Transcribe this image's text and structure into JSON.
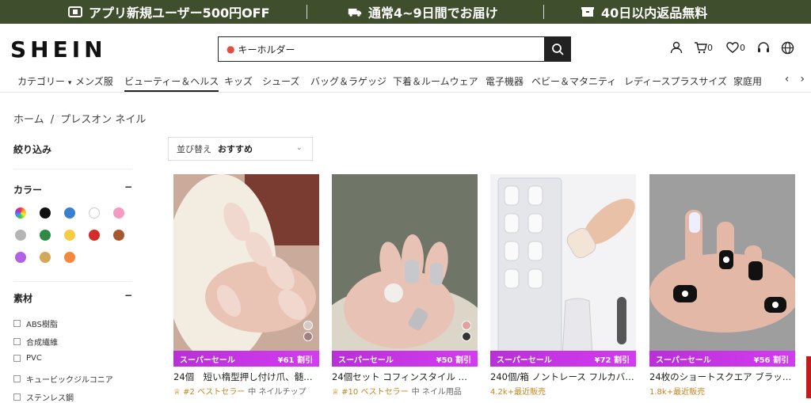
{
  "promo": {
    "items": [
      {
        "icon": "ticket-icon",
        "text": "アプリ新規ユーザー500円OFF"
      },
      {
        "icon": "truck-icon",
        "text": "通常4~9日間でお届け"
      },
      {
        "icon": "return-box-icon",
        "text": "40日以内返品無料"
      }
    ]
  },
  "header": {
    "logo": "SHEIN",
    "search": {
      "value": "キーホルダー",
      "icon": "search-icon"
    },
    "cart_count": "0",
    "wishlist_count": "0"
  },
  "nav": {
    "items": [
      "カテゴリー",
      "メンズ服",
      "ビューティー＆ヘルス",
      "キッズ",
      "シューズ",
      "バッグ＆ラゲッジ",
      "下着＆ルームウェア",
      "電子機器",
      "ベビー＆マタニティ",
      "レディースプラスサイズ",
      "家庭用"
    ],
    "active_index": 2
  },
  "breadcrumb": {
    "home": "ホーム",
    "separator": "/",
    "current": "プレスオン ネイル"
  },
  "filters": {
    "title": "絞り込み",
    "color": {
      "label": "カラー",
      "toggle": "−",
      "swatches": [
        "#f28c28",
        "#111111",
        "#3a7fd0",
        "#ffffff",
        "#f59ac2",
        "#b5b5b5",
        "#2e8b46",
        "#f5cd45",
        "#d32a2a",
        "#a8582e",
        "#b161e6",
        "#d4a85a",
        "#f6883e"
      ]
    },
    "material": {
      "label": "素材",
      "toggle": "−",
      "options": [
        "ABS樹脂",
        "合成繊維",
        "PVC",
        "キュービックジルコニア",
        "ステンレス鋼"
      ]
    }
  },
  "sort": {
    "label": "並び替え",
    "value": "おすすめ"
  },
  "products": [
    {
      "sale": "スーパーセール",
      "discount": "¥61 割引",
      "title": "24個　短い楕型押し付け爪、髄…",
      "badge": "#2 ベストセラー",
      "category": "中 ネイルチップ",
      "sold": ""
    },
    {
      "sale": "スーパーセール",
      "discount": "¥50 割引",
      "title": "24個セット コフィンスタイル …",
      "badge": "#10 ベストセラー",
      "category": "中 ネイル用品",
      "sold": ""
    },
    {
      "sale": "スーパーセール",
      "discount": "¥72 割引",
      "title": "240個/箱 ノントレース フルカバ…",
      "badge": "",
      "category": "",
      "sold": "4.2k+最近販売"
    },
    {
      "sale": "スーパーセール",
      "discount": "¥56 割引",
      "title": "24枚のショートスクエア ブラッ…",
      "badge": "",
      "category": "",
      "sold": "1.8k+最近販売"
    }
  ]
}
